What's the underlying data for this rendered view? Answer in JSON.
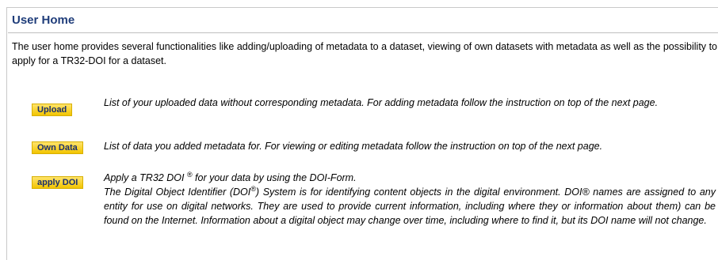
{
  "page": {
    "title": "User Home",
    "intro": "The user home provides several functionalities like adding/uploading of metadata to a dataset, viewing of own datasets with metadata as well as the possibility to apply for a TR32-DOI for a dataset."
  },
  "items": [
    {
      "button": "Upload",
      "text": "List of your uploaded data without corresponding metadata. For adding metadata follow the instruction on top of the next page."
    },
    {
      "button": "Own Data",
      "text": "List of data you added metadata for. For viewing or editing metadata follow the instruction on top of the next page."
    },
    {
      "button": "apply DOI",
      "line1_pre": "Apply a TR32 DOI ",
      "line1_sup": "®",
      "line1_post": " for your data by using the DOI-Form.",
      "para_pre": "The Digital Object Identifier (DOI",
      "para_sup": "®",
      "para_post": ") System is for identifying content objects in the digital environment. DOI® names are assigned to any entity for use on digital networks. They are used to provide current information, including where they or information about them) can be found on the Internet. Information about a digital object may change over time, including where to find it, but its DOI name will not change."
    }
  ]
}
